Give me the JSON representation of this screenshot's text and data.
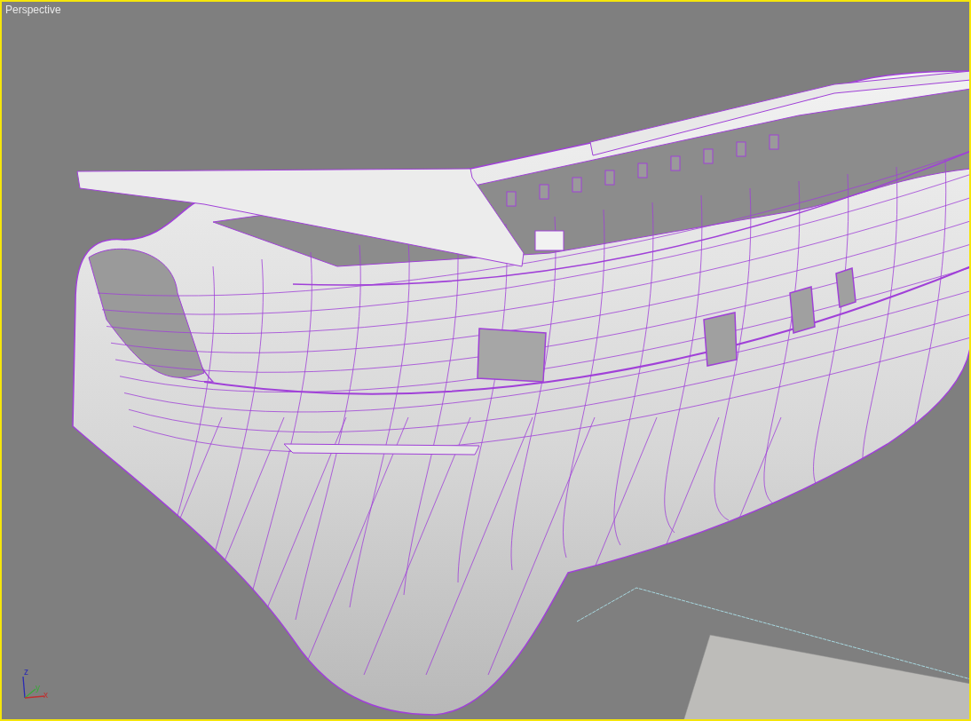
{
  "viewport": {
    "label": "Perspective",
    "active": true
  },
  "axis_gizmo": {
    "labels": [
      {
        "kind": "z",
        "text": "z",
        "color": "#2a2ab4"
      },
      {
        "kind": "y",
        "text": "y",
        "color": "#3aa83a"
      },
      {
        "kind": "x",
        "text": "x",
        "color": "#c03030"
      }
    ]
  }
}
